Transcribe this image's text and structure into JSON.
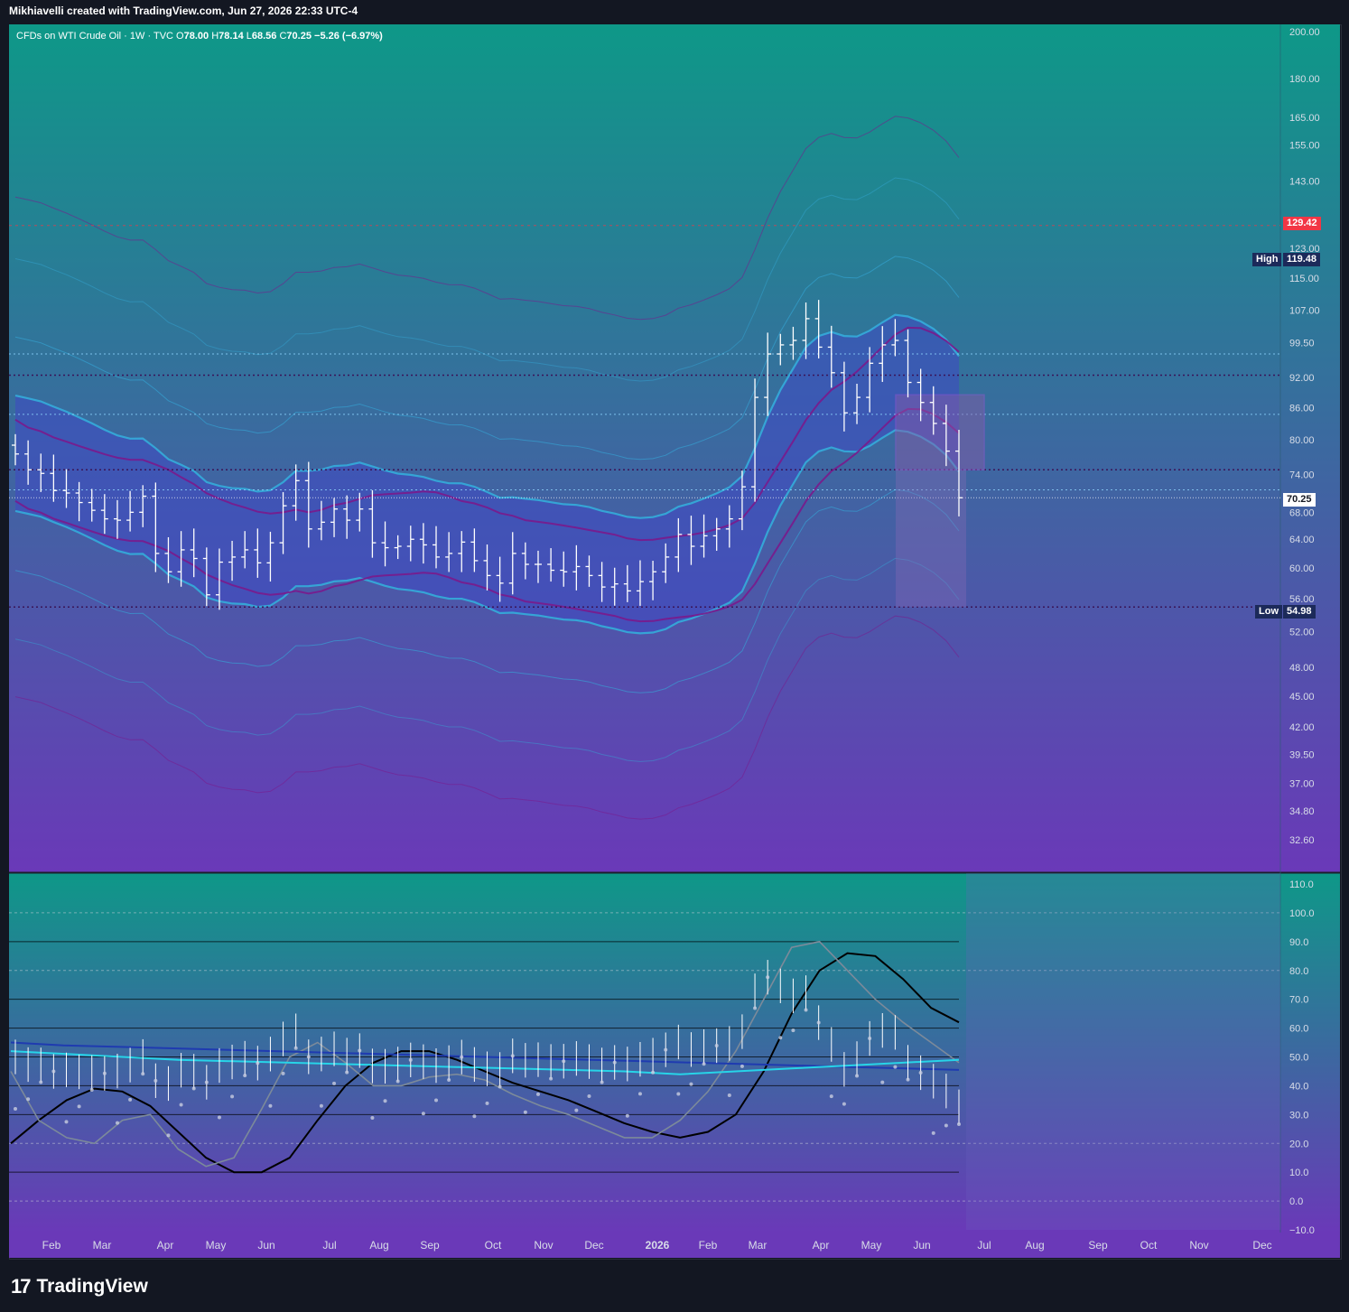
{
  "header": {
    "text": "Mikhiavelli created with TradingView.com, Jun 27, 2026 22:33 UTC-4"
  },
  "legend": {
    "symbol": "CFDs on WTI Crude Oil · 1W · TVC",
    "o_label": "O",
    "o": "78.00",
    "h_label": "H",
    "h": "78.14",
    "l_label": "L",
    "l": "68.56",
    "c_label": "C",
    "c": "70.25",
    "change": "−5.26 (−6.97%)"
  },
  "badges": {
    "level_red": "129.42",
    "high_label": "High",
    "high": "119.48",
    "last": "70.25",
    "low_label": "Low",
    "low": "54.98"
  },
  "colors": {
    "bg_top": "#0e9888",
    "bg_bottom": "#6a39b8",
    "bar": "#ffffff",
    "band_blue": "#35a9d8",
    "band_purple": "#7a1a8c",
    "red_badge": "#f23645",
    "navy_badge": "#1c2a5a",
    "osc_black": "#000000",
    "osc_grey": "#7c8a9a",
    "osc_blue": "#1f3bb0",
    "osc_cyan": "#27d4e8"
  },
  "chart_data": [
    {
      "type": "bar",
      "title": "CFDs on WTI Crude Oil · 1W · TVC",
      "y_scale": "log",
      "ylim": [
        30.5,
        202
      ],
      "y_ticks": [
        "200.00",
        "180.00",
        "165.00",
        "155.00",
        "143.00",
        "131.00",
        "123.00",
        "115.00",
        "107.00",
        "99.50",
        "92.00",
        "86.00",
        "80.00",
        "74.00",
        "68.00",
        "64.00",
        "60.00",
        "56.00",
        "52.00",
        "48.00",
        "45.00",
        "42.00",
        "39.50",
        "37.00",
        "34.80",
        "32.60"
      ],
      "x_ticks": [
        "Feb",
        "Mar",
        "Apr",
        "May",
        "Jun",
        "Jul",
        "Aug",
        "Sep",
        "Oct",
        "Nov",
        "Dec",
        "2026",
        "Feb",
        "Mar",
        "Apr",
        "May",
        "Jun",
        "Jul",
        "Aug",
        "Sep",
        "Oct",
        "Nov",
        "Dec"
      ],
      "ohlc_closes": [
        77.5,
        74.8,
        74.2,
        71.4,
        71.0,
        69.5,
        68.3,
        67.0,
        66.8,
        68.0,
        70.5,
        62.0,
        59.5,
        62.5,
        61.3,
        56.5,
        60.8,
        61.5,
        62.5,
        60.7,
        63.5,
        69.0,
        73.0,
        65.5,
        66.5,
        68.5,
        66.8,
        68.5,
        63.5,
        62.8,
        63.0,
        64.0,
        63.2,
        61.5,
        62.0,
        63.6,
        61.0,
        59.0,
        58.0,
        62.0,
        60.5,
        60.5,
        59.7,
        59.5,
        60.2,
        59.0,
        57.5,
        57.9,
        57.0,
        58.2,
        59.5,
        61.5,
        64.7,
        63.0,
        64.5,
        65.5,
        67.0,
        72.0,
        88.0,
        97.0,
        99.0,
        100.0,
        105.0,
        98.5,
        93.0,
        85.0,
        88.0,
        95.0,
        99.0,
        100.0,
        91.0,
        87.0,
        83.0,
        78.0,
        70.25
      ],
      "levels_dotted": [
        92.5,
        74.8,
        54.98
      ],
      "levels_blue_dotted": [
        97.0,
        84.7,
        71.5
      ]
    },
    {
      "type": "line",
      "ylim": [
        -10,
        110
      ],
      "y_ticks": [
        "110.0",
        "100.0",
        "90.0",
        "80.0",
        "70.0",
        "60.0",
        "50.0",
        "40.0",
        "30.0",
        "20.0",
        "10.0",
        "0.0",
        "−10.0"
      ],
      "series": [
        {
          "values": [
            20,
            28,
            35,
            39,
            38,
            33,
            24,
            15,
            10,
            10,
            15,
            28,
            40,
            48,
            52,
            52,
            49,
            45,
            41,
            38,
            35,
            31,
            27,
            24,
            22,
            24,
            30,
            45,
            65,
            80,
            86,
            85,
            77,
            67,
            62
          ]
        },
        {
          "values": [
            45,
            28,
            22,
            20,
            28,
            30,
            18,
            12,
            15,
            32,
            50,
            55,
            48,
            40,
            40,
            43,
            44,
            42,
            37,
            33,
            30,
            26,
            22,
            22,
            28,
            38,
            52,
            70,
            88,
            90,
            80,
            70,
            62,
            55,
            48
          ]
        },
        {
          "values": [
            55,
            54,
            53.5,
            53,
            52.5,
            52,
            51.5,
            51,
            50.5,
            50,
            49.5,
            49,
            48.5,
            48,
            47.5,
            47,
            46.5,
            46,
            45.5
          ]
        },
        {
          "values": [
            52,
            51,
            50,
            49,
            48.5,
            48,
            47.5,
            47,
            46.5,
            46,
            45.5,
            45,
            44,
            45,
            46,
            47,
            48,
            49
          ]
        }
      ]
    }
  ]
}
